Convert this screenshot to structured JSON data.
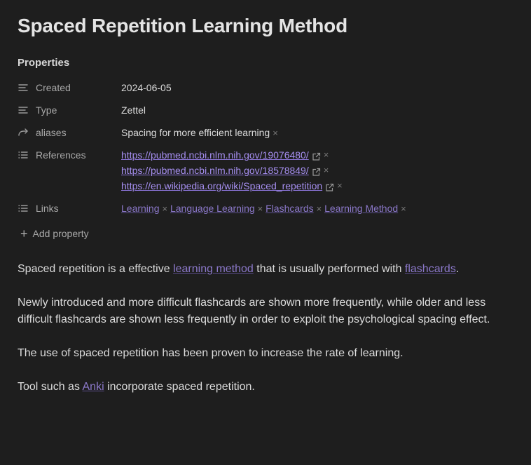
{
  "page": {
    "title": "Spaced Repetition Learning Method"
  },
  "properties": {
    "heading": "Properties",
    "created": {
      "key": "Created",
      "icon": "text-lines-icon",
      "value": "2024-06-05"
    },
    "type": {
      "key": "Type",
      "icon": "text-lines-icon",
      "value": "Zettel"
    },
    "aliases": {
      "key": "aliases",
      "icon": "forward-arrow-icon",
      "values": [
        "Spacing for more efficient learning"
      ]
    },
    "references": {
      "key": "References",
      "icon": "list-icon",
      "values": [
        "https://pubmed.ncbi.nlm.nih.gov/19076480/",
        "https://pubmed.ncbi.nlm.nih.gov/18578849/",
        "https://en.wikipedia.org/wiki/Spaced_repetition"
      ]
    },
    "links": {
      "key": "Links",
      "icon": "list-icon",
      "values": [
        "Learning",
        "Language Learning",
        "Flashcards",
        "Learning Method"
      ]
    },
    "remove_glyph": "×",
    "add_property_label": "Add property",
    "add_property_icon": "+"
  },
  "content": {
    "p1": {
      "before": "Spaced repetition is a effective ",
      "link1": "learning method",
      "middle": " that is usually performed with ",
      "link2": "flashcards",
      "after": "."
    },
    "p2": "Newly introduced and more difficult flashcards are shown more frequently, while older and less difficult flashcards are shown less frequently in order to exploit the psychological spacing effect.",
    "p3": "The use of spaced repetition has been proven to increase the rate of learning.",
    "p4": {
      "before": "Tool such as ",
      "link": "Anki",
      "after": " incorporate spaced repetition."
    }
  },
  "colors": {
    "background": "#1e1e1e",
    "text": "#dcdcdc",
    "muted": "#a8a8a8",
    "external_link": "#a68ff0",
    "internal_link": "#8b78c9"
  }
}
